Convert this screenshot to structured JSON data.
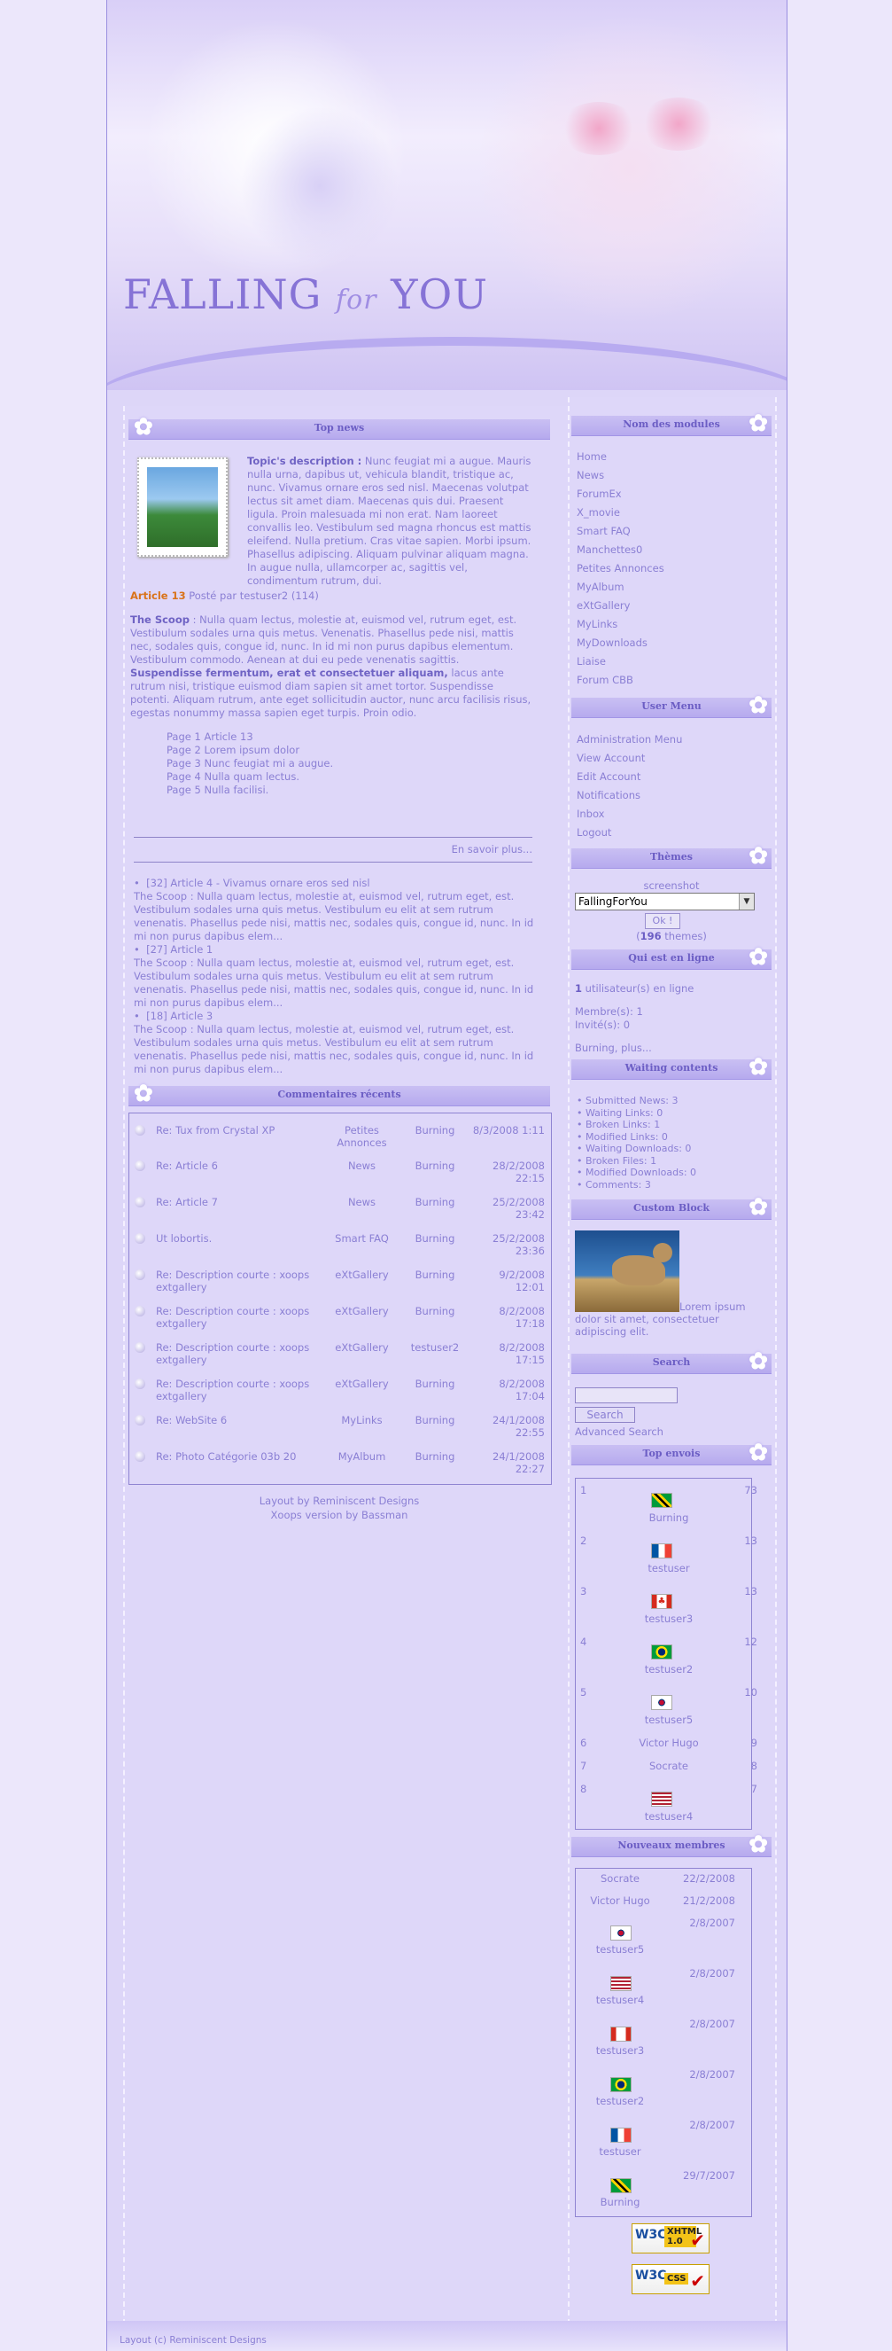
{
  "site": {
    "logo": "FALLING",
    "logo_small": "for",
    "logo_end": "YOU"
  },
  "top_news": {
    "title": "Top news",
    "desc_label": "Topic's description :",
    "desc_text": " Nunc feugiat mi a augue. Mauris nulla urna, dapibus ut, vehicula blandit, tristique ac, nunc. Vivamus ornare eros sed nisl. Maecenas volutpat lectus sit amet diam. Maecenas quis dui. Praesent ligula. Proin malesuada mi non erat. Nam laoreet convallis leo. Vestibulum sed magna rhoncus est mattis eleifend. Nulla pretium. Cras vitae sapien. Morbi ipsum. Phasellus adipiscing. Aliquam pulvinar aliquam magna. In augue nulla, ullamcorper ac, sagittis vel, condimentum rutrum, dui.",
    "article_title": "Article 13",
    "article_meta": " Posté par testuser2 (114)",
    "scoop_label": "The Scoop",
    "scoop_text1": " : Nulla quam lectus, molestie at, euismod vel, rutrum eget, est. Vestibulum sodales urna quis metus. Venenatis. Phasellus pede nisi, mattis nec, sodales quis, congue id, nunc. In id mi non purus dapibus elementum. Vestibulum commodo. Aenean at dui eu pede venenatis sagittis. ",
    "scoop_bold": "Suspendisse fermentum, erat et consectetuer aliquam,",
    "scoop_text2": " lacus ante rutrum nisi, tristique euismod diam sapien sit amet tortor. Suspendisse potenti. Aliquam rutrum, ante eget sollicitudin auctor, nunc arcu facilisis risus, egestas nonummy massa sapien eget turpis. Proin odio.",
    "pages": [
      "Page 1 Article 13",
      "Page 2 Lorem ipsum dolor",
      "Page 3 Nunc feugiat mi a augue.",
      "Page 4 Nulla quam lectus.",
      "Page 5 Nulla facilisi."
    ],
    "more": "En savoir plus...",
    "recent": [
      {
        "title": "[32] Article 4 - Vivamus ornare eros sed nisl",
        "text": "The Scoop : Nulla quam lectus, molestie at, euismod vel, rutrum eget, est. Vestibulum sodales urna quis metus. Vestibulum eu elit at sem rutrum venenatis. Phasellus pede nisi, mattis nec, sodales quis, congue id, nunc. In id mi non purus dapibus elem..."
      },
      {
        "title": "[27] Article 1",
        "text": "The Scoop : Nulla quam lectus, molestie at, euismod vel, rutrum eget, est. Vestibulum sodales urna quis metus. Vestibulum eu elit at sem rutrum venenatis. Phasellus pede nisi, mattis nec, sodales quis, congue id, nunc. In id mi non purus dapibus elem..."
      },
      {
        "title": "[18] Article 3",
        "text": "The Scoop : Nulla quam lectus, molestie at, euismod vel, rutrum eget, est. Vestibulum sodales urna quis metus. Vestibulum eu elit at sem rutrum venenatis. Phasellus pede nisi, mattis nec, sodales quis, congue id, nunc. In id mi non purus dapibus elem..."
      }
    ]
  },
  "comments": {
    "title": "Commentaires récents",
    "rows": [
      {
        "t": "Re: Tux from Crystal XP",
        "m": "Petites Annonces",
        "u": "Burning",
        "d": "8/3/2008 1:11"
      },
      {
        "t": "Re: Article 6",
        "m": "News",
        "u": "Burning",
        "d": "28/2/2008 22:15"
      },
      {
        "t": "Re: Article 7",
        "m": "News",
        "u": "Burning",
        "d": "25/2/2008 23:42"
      },
      {
        "t": "Ut lobortis.",
        "m": "Smart FAQ",
        "u": "Burning",
        "d": "25/2/2008 23:36"
      },
      {
        "t": "Re: Description courte : xoops extgallery",
        "m": "eXtGallery",
        "u": "Burning",
        "d": "9/2/2008 12:01"
      },
      {
        "t": "Re: Description courte : xoops extgallery",
        "m": "eXtGallery",
        "u": "Burning",
        "d": "8/2/2008 17:18"
      },
      {
        "t": "Re: Description courte : xoops extgallery",
        "m": "eXtGallery",
        "u": "testuser2",
        "d": "8/2/2008 17:15"
      },
      {
        "t": "Re: Description courte : xoops extgallery",
        "m": "eXtGallery",
        "u": "Burning",
        "d": "8/2/2008 17:04"
      },
      {
        "t": "Re: WebSite 6",
        "m": "MyLinks",
        "u": "Burning",
        "d": "24/1/2008 22:55"
      },
      {
        "t": "Re: Photo Catégorie 03b 20",
        "m": "MyAlbum",
        "u": "Burning",
        "d": "24/1/2008 22:27"
      }
    ]
  },
  "footer": {
    "line1": "Layout by Reminiscent Designs",
    "line2": "Xoops version by Bassman",
    "bottom": "Layout (c) Reminiscent Designs"
  },
  "modules": {
    "title": "Nom des modules",
    "items": [
      "Home",
      "News",
      "ForumEx",
      "X_movie",
      "Smart FAQ",
      "Manchettes0",
      "Petites Annonces",
      "MyAlbum",
      "eXtGallery",
      "MyLinks",
      "MyDownloads",
      "Liaise",
      "Forum CBB"
    ]
  },
  "user_menu": {
    "title": "User Menu",
    "items": [
      "Administration Menu",
      "View Account",
      "Edit Account",
      "Notifications",
      "Inbox",
      "Logout"
    ]
  },
  "themes": {
    "title": "Thèmes",
    "label": "screenshot",
    "selected": "FallingForYou",
    "ok": "Ok !",
    "count_open": "(",
    "count": "196",
    "count_close": " themes)"
  },
  "online": {
    "title": "Qui est en ligne",
    "count": "1",
    "count_text": " utilisateur(s) en ligne",
    "members": "Membre(s): 1",
    "guests": "Invité(s): 0",
    "list": "Burning, plus..."
  },
  "waiting": {
    "title": "Waiting contents",
    "items": [
      "Submitted News: 3",
      "Waiting Links: 0",
      "Broken Links: 1",
      "Modified Links: 0",
      "Waiting Downloads: 0",
      "Broken Files: 1",
      "Modified Downloads: 0",
      "Comments: 3"
    ]
  },
  "custom": {
    "title": "Custom Block",
    "text": " Lorem ipsum dolor sit amet, consectetuer adipiscing elit."
  },
  "search": {
    "title": "Search",
    "button": "Search",
    "advanced": "Advanced Search"
  },
  "top_posters": {
    "title": "Top envois",
    "rows": [
      {
        "n": "1",
        "v": "73",
        "u": "Burning",
        "flag": "jm"
      },
      {
        "n": "2",
        "v": "13",
        "u": "testuser",
        "flag": "fr"
      },
      {
        "n": "3",
        "v": "13",
        "u": "testuser3",
        "flag": "ca"
      },
      {
        "n": "4",
        "v": "12",
        "u": "testuser2",
        "flag": "br"
      },
      {
        "n": "5",
        "v": "10",
        "u": "testuser5",
        "flag": "kr"
      },
      {
        "n": "6",
        "v": "9",
        "u": "Victor Hugo"
      },
      {
        "n": "7",
        "v": "8",
        "u": "Socrate"
      },
      {
        "n": "8",
        "v": "7",
        "u": "testuser4",
        "flag": "us"
      }
    ]
  },
  "new_members": {
    "title": "Nouveaux membres",
    "rows": [
      {
        "u": "Socrate",
        "d": "22/2/2008"
      },
      {
        "u": "Victor Hugo",
        "d": "21/2/2008"
      },
      {
        "u": "testuser5",
        "d": "2/8/2007",
        "flag": "kr"
      },
      {
        "u": "testuser4",
        "d": "2/8/2007",
        "flag": "us"
      },
      {
        "u": "testuser3",
        "d": "2/8/2007",
        "flag": "ca"
      },
      {
        "u": "testuser2",
        "d": "2/8/2007",
        "flag": "br"
      },
      {
        "u": "testuser",
        "d": "2/8/2007",
        "flag": "fr"
      },
      {
        "u": "Burning",
        "d": "29/7/2007",
        "flag": "jm"
      }
    ]
  },
  "badges": {
    "xhtml_w3c": "W3C",
    "xhtml": "XHTML 1.0",
    "css_w3c": "W3C",
    "css": "CSS"
  },
  "colors": {
    "accent": "#8a7fd4",
    "orange": "#d9731a",
    "band": "#b6aaee"
  }
}
